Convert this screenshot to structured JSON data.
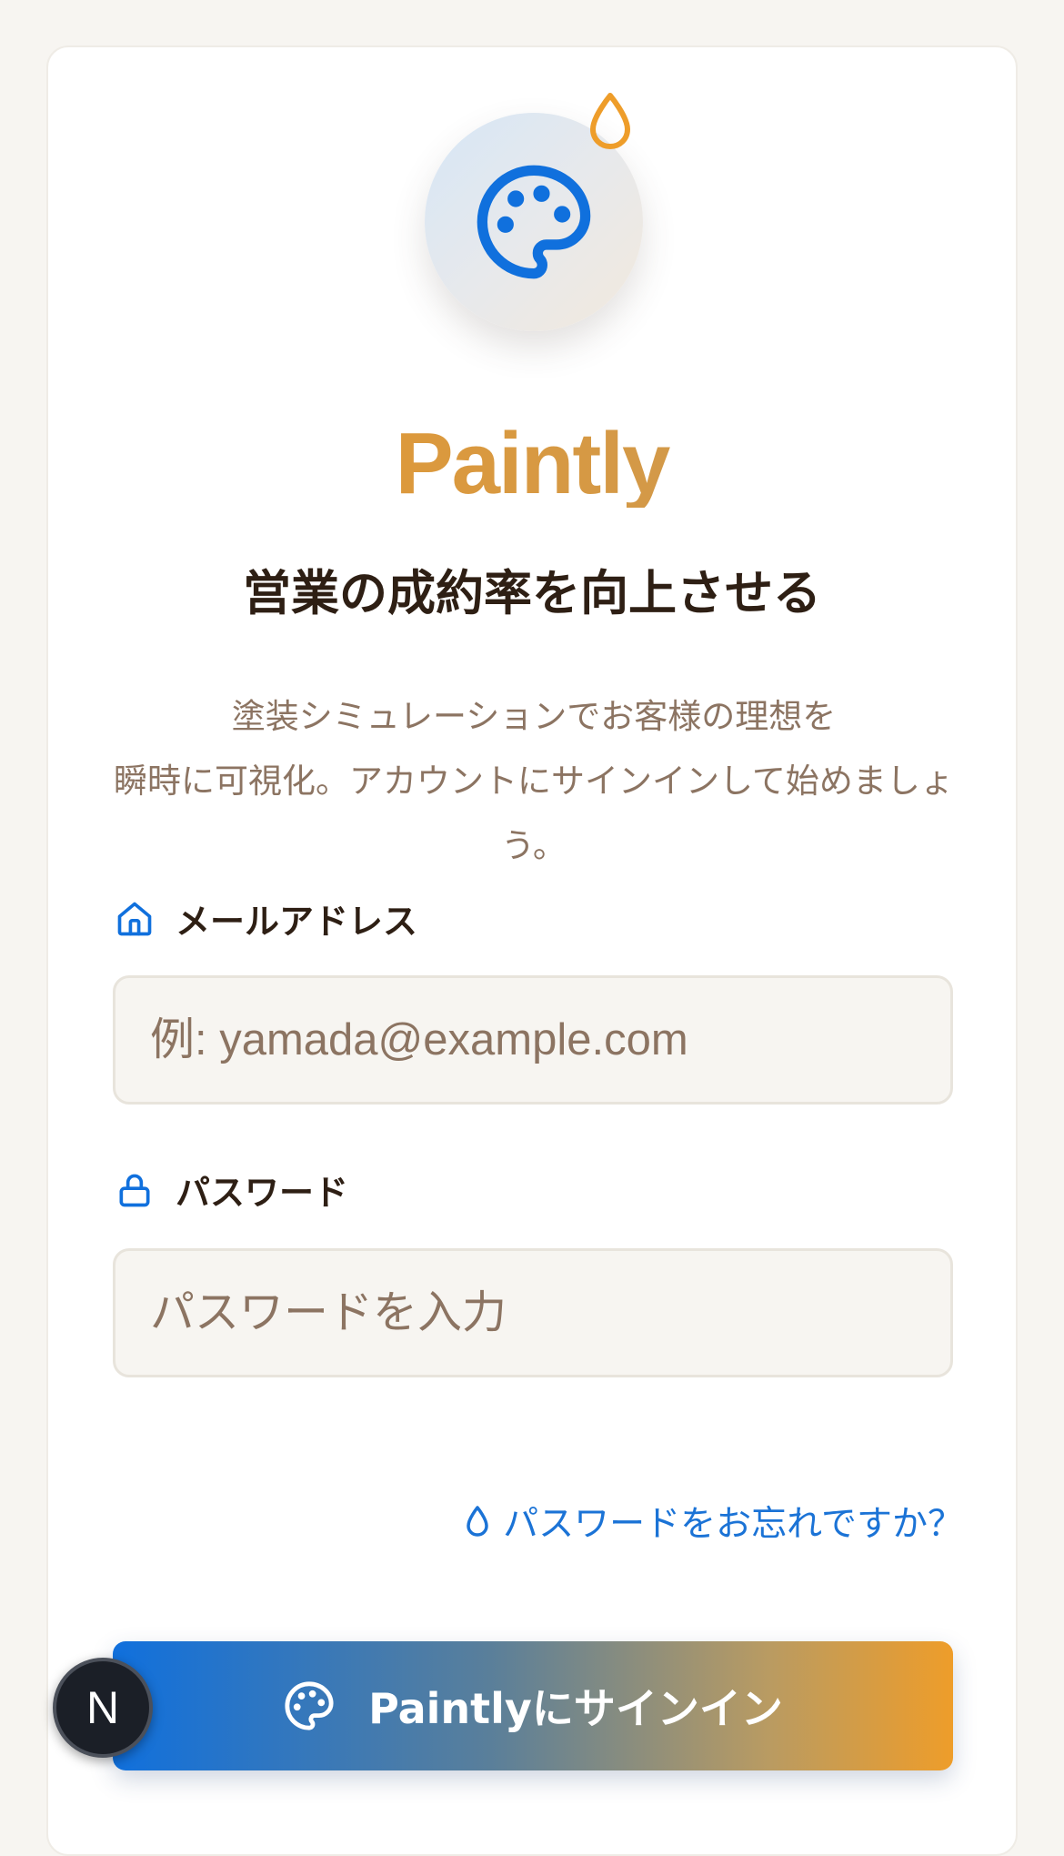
{
  "brand": {
    "name": "Paintly",
    "logo_icon": "palette-icon",
    "accent_icon": "paint-drop-icon"
  },
  "headline": "営業の成約率を向上させる",
  "description": {
    "line1": "塗装シミュレーションでお客様の理想を",
    "line2": "瞬時に可視化。アカウントにサインインして始めましょ",
    "line3": "う。"
  },
  "form": {
    "email": {
      "label": "メールアドレス",
      "icon": "home-icon",
      "value": "",
      "placeholder": "例: yamada@example.com"
    },
    "password": {
      "label": "パスワード",
      "icon": "lock-icon",
      "value": "",
      "placeholder": "パスワードを入力"
    },
    "forgot_link": "パスワードをお忘れですか？",
    "submit_label": "Paintlyにサインイン"
  },
  "badge": {
    "letter": "N"
  },
  "colors": {
    "brand_orange": "#e8982c",
    "link_blue": "#1b73d6",
    "text_dark": "#2e1f14",
    "text_muted": "#8c7462",
    "page_bg": "#f7f5f1"
  }
}
